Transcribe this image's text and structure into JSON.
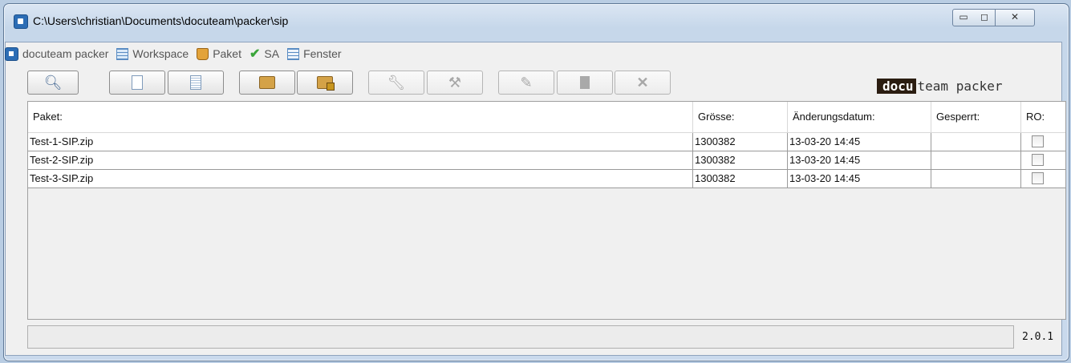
{
  "window": {
    "title": "C:\\Users\\christian\\Documents\\docuteam\\packer\\sip",
    "controls": {
      "minimize": "▭",
      "maximize": "◻",
      "close": "✕"
    }
  },
  "menubar": {
    "items": [
      {
        "label": "docuteam packer",
        "icon": "app-logo-icon"
      },
      {
        "label": "Workspace",
        "icon": "workspace-icon"
      },
      {
        "label": "Paket",
        "icon": "package-icon"
      },
      {
        "label": "SA",
        "icon": "check-icon"
      },
      {
        "label": "Fenster",
        "icon": "window-list-icon"
      }
    ]
  },
  "toolbar": {
    "buttons": [
      {
        "name": "search-button",
        "icon": "magnifier-icon",
        "enabled": true
      },
      {
        "name": "new-package-button",
        "icon": "new-document-icon",
        "enabled": true
      },
      {
        "name": "new-from-template-button",
        "icon": "document-lines-icon",
        "enabled": true
      },
      {
        "name": "open-package-button",
        "icon": "folder-open-icon",
        "enabled": true
      },
      {
        "name": "open-locked-package-button",
        "icon": "folder-lock-icon",
        "enabled": true
      },
      {
        "name": "tool-button",
        "icon": "wrench-icon",
        "enabled": false
      },
      {
        "name": "tools-button",
        "icon": "wrench-gear-icon",
        "enabled": false
      },
      {
        "name": "edit-button",
        "icon": "pencil-icon",
        "enabled": false
      },
      {
        "name": "copy-button",
        "icon": "page-icon",
        "enabled": false
      },
      {
        "name": "delete-button",
        "icon": "x-icon",
        "enabled": false
      }
    ]
  },
  "brand": {
    "part1": "docu",
    "part2": "team packer"
  },
  "table": {
    "headers": [
      "Paket:",
      "Grösse:",
      "Änderungsdatum:",
      "Gesperrt:",
      "RO:"
    ],
    "rows": [
      {
        "paket": "Test-1-SIP.zip",
        "groesse": "1300382",
        "datum": "13-03-20 14:45",
        "gesperrt": "",
        "ro": false
      },
      {
        "paket": "Test-2-SIP.zip",
        "groesse": "1300382",
        "datum": "13-03-20 14:45",
        "gesperrt": "",
        "ro": false
      },
      {
        "paket": "Test-3-SIP.zip",
        "groesse": "1300382",
        "datum": "13-03-20 14:45",
        "gesperrt": "",
        "ro": false
      }
    ]
  },
  "status": {
    "text": "",
    "version": "2.0.1"
  }
}
